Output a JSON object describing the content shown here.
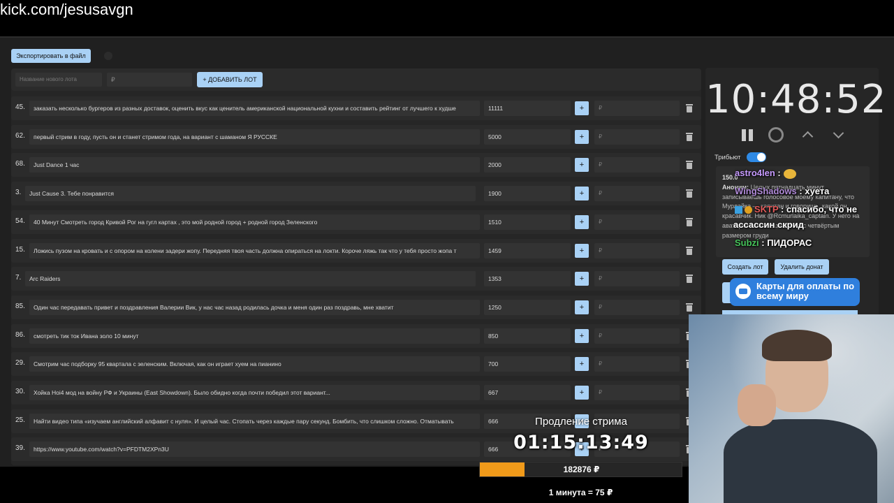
{
  "browser": {
    "url": "kick.com/jesusavgn"
  },
  "toolbar": {
    "export_label": "Экспортировать в файл"
  },
  "add_lot": {
    "name_placeholder": "Название нового лота",
    "price_placeholder": "₽",
    "add_label": "+ ДОБАВИТЬ ЛОТ"
  },
  "lots": [
    {
      "num": "45.",
      "title": "заказать несколько бургеров из разных доставок, оценить вкус как ценитель американской национальной кухни и составить рейтинг от лучшего к худше",
      "amount": "11111"
    },
    {
      "num": "62.",
      "title": "первый стрим в году, пусть он и станет стримом года, на вариант с шаманом Я РУССКЕ",
      "amount": "5000"
    },
    {
      "num": "68.",
      "title": "Just Dance 1 час",
      "amount": "2000"
    },
    {
      "num": "3.",
      "title": "Just Cause 3. Тебе понравится",
      "amount": "1900"
    },
    {
      "num": "54.",
      "title": "40 Минут Смотреть город Кривой Рог на гугл картах , это мой родной город + родной город Зеленского",
      "amount": "1510"
    },
    {
      "num": "15.",
      "title": "Ложись пузом на кровать и с опором на колени задери жопу. Передняя твоя часть должна опираться на локти. Короче ляжь так что у тебя просто жопа т",
      "amount": "1459"
    },
    {
      "num": "7.",
      "title": "Arc Raiders",
      "amount": "1353"
    },
    {
      "num": "85.",
      "title": "Один час передавать привет и поздравления Валерии Вик, у нас час назад родилась дочка и меня один раз поздравь, мне хватит",
      "amount": "1250"
    },
    {
      "num": "86.",
      "title": "смотреть тик ток Ивана золо 10 минут",
      "amount": "850"
    },
    {
      "num": "29.",
      "title": "Смотрим час подборку 95 квартала с зеленским. Включая, как он играет хуем на пианино",
      "amount": "700"
    },
    {
      "num": "30.",
      "title": "Хойка Hoi4 мод на войну РФ и Украины (East Showdown). Было обидно когда почти победил этот вариант...",
      "amount": "667"
    },
    {
      "num": "25.",
      "title": "Найти видео типа «изучаем английский алфавит с нуля». И целый час. Стопать через каждые пару секунд. Бомбить, что слишком сложно. Отматывать",
      "amount": "666"
    },
    {
      "num": "39.",
      "title": "https://www.youtube.com/watch?v=PFDTM2XPn3U",
      "amount": "666"
    }
  ],
  "lot_controls": {
    "plus": "+",
    "rub_placeholder": "₽"
  },
  "timer": {
    "time": "10:48:52"
  },
  "tribute": {
    "label": "Трибьют",
    "enabled": true
  },
  "donate": {
    "amount": "150.0",
    "author": "Аноним:",
    "text": "Целых пятнадцать минут записываешь голосовое моему капитану, что Мурлайка — капитан и говоришь, какой он красавчик. Ник @Rcmurlaika_captain. У него на аватарке сочная азиаточка с четвёртым размером груди"
  },
  "chat": [
    {
      "user": "astro4len",
      "sep": " :",
      "msg": "",
      "color": "#c79bff"
    },
    {
      "user": "WingShadows",
      "sep": " :",
      "msg": " хуета",
      "color": "#b08ad8"
    },
    {
      "user": "SKTP",
      "sep": " :",
      "msg": " спасибо, что не",
      "color": "#e25a5a"
    },
    {
      "user": "",
      "sep": "",
      "msg": "ассассин скрид",
      "color": "#ffffff"
    },
    {
      "user": "Subzi",
      "sep": " :",
      "msg": " ПИДОРАС",
      "color": "#46c35a"
    }
  ],
  "actions": {
    "create_lot": "Создать лот",
    "delete_donate": "Удалить донат"
  },
  "ad": {
    "text": "Карты для оплаты по всему миру"
  },
  "extension": {
    "title": "Продление стрима",
    "timer": "01:15:13:49",
    "total": "182876 ₽",
    "progress_fraction": 0.22,
    "rate": "1 минута = 75 ₽"
  },
  "colors": {
    "accent": "#a9d1f5",
    "progress": "#f09a1a",
    "toggle": "#2e8ae6"
  }
}
